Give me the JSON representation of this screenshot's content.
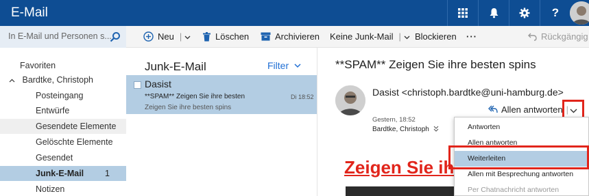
{
  "app": {
    "title": "E-Mail"
  },
  "topbar": {
    "icons": [
      "app-launcher-icon",
      "bell-icon",
      "gear-icon",
      "help-icon"
    ],
    "help_label": "?"
  },
  "search": {
    "placeholder": "In E-Mail und Personen s..."
  },
  "commands": {
    "new": "Neu",
    "delete": "Löschen",
    "archive": "Archivieren",
    "junk": "Keine Junk-Mail",
    "block": "Blockieren",
    "more": "···",
    "undo": "Rückgängig"
  },
  "sidebar": {
    "favorites": "Favoriten",
    "account": "Bardtke, Christoph",
    "items": [
      {
        "label": "Posteingang"
      },
      {
        "label": "Entwürfe"
      },
      {
        "label": "Gesendete Elemente"
      },
      {
        "label": "Gelöschte Elemente"
      },
      {
        "label": "Gesendet"
      },
      {
        "label": "Junk-E-Mail",
        "count": "1"
      },
      {
        "label": "Notizen"
      }
    ]
  },
  "list": {
    "title": "Junk-E-Mail",
    "filter": "Filter",
    "messages": [
      {
        "from": "Dasist",
        "subject": "**SPAM** Zeigen Sie ihre besten",
        "time": "Di 18:52",
        "preview": "Zeigen Sie ihre besten spins"
      }
    ]
  },
  "reading": {
    "subject": "**SPAM** Zeigen Sie ihre besten spins",
    "from": "Dasist <christoph.bardtke@uni-hamburg.de>",
    "reply_all": "Allen antworten",
    "date": "Gestern, 18:52",
    "to": "Bardtke, Christoph",
    "body_heading": "Zeigen Sie ih"
  },
  "menu": {
    "items": [
      {
        "label": "Antworten"
      },
      {
        "label": "Allen antworten"
      },
      {
        "label": "Weiterleiten"
      },
      {
        "label": "Allen mit Besprechung antworten"
      },
      {
        "label": "Per Chatnachricht antworten"
      }
    ]
  },
  "colors": {
    "brand": "#0e4d93",
    "selection": "#b3cde3",
    "highlight": "#e1251b",
    "link": "#1f6ed4"
  }
}
